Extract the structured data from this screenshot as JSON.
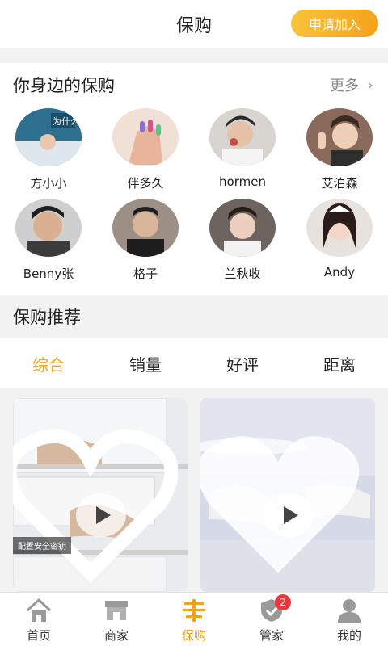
{
  "header": {
    "title": "保购",
    "apply_label": "申请加入"
  },
  "nearby": {
    "title": "你身边的保购",
    "more_label": "更多",
    "people": [
      {
        "name": "方小小"
      },
      {
        "name": "伴多久"
      },
      {
        "name": "hormen"
      },
      {
        "name": "艾泊森"
      },
      {
        "name": "Benny张"
      },
      {
        "name": "格子"
      },
      {
        "name": "兰秋收"
      },
      {
        "name": "Andy"
      }
    ]
  },
  "recommend": {
    "title": "保购推荐",
    "tabs": [
      {
        "label": "综合",
        "active": true
      },
      {
        "label": "销量",
        "active": false
      },
      {
        "label": "好评",
        "active": false
      },
      {
        "label": "距离",
        "active": false
      }
    ],
    "cards": [
      {
        "caption": "配置安全密钥"
      },
      {
        "caption": ""
      }
    ]
  },
  "tabbar": {
    "items": [
      {
        "label": "首页",
        "icon": "home-icon"
      },
      {
        "label": "商家",
        "icon": "shop-icon"
      },
      {
        "label": "保购",
        "icon": "baogou-icon",
        "active": true
      },
      {
        "label": "管家",
        "icon": "butler-icon",
        "badge": "2"
      },
      {
        "label": "我的",
        "icon": "profile-icon"
      }
    ]
  },
  "colors": {
    "accent": "#f0a51e",
    "badge": "#e8383d"
  }
}
